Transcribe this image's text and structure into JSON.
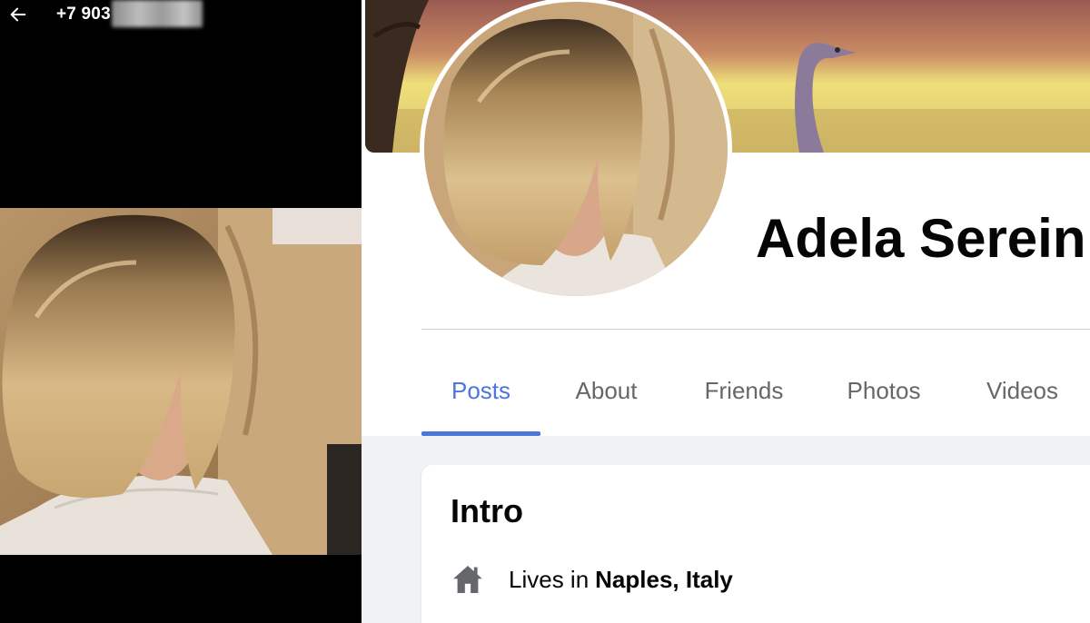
{
  "phone_viewer": {
    "back_icon": "arrow-left-icon",
    "phone_number_visible": "+7 903",
    "phone_number_redacted": true
  },
  "profile": {
    "name": "Adela Serein",
    "tabs": [
      {
        "label": "Posts",
        "active": true
      },
      {
        "label": "About",
        "active": false
      },
      {
        "label": "Friends",
        "active": false
      },
      {
        "label": "Photos",
        "active": false
      },
      {
        "label": "Videos",
        "active": false
      }
    ],
    "intro": {
      "title": "Intro",
      "lives_prefix": "Lives in",
      "lives_place": "Naples, Italy",
      "icon": "home-icon"
    }
  },
  "colors": {
    "accent": "#4a76de",
    "tab_text": "#65676b",
    "page_bg": "#f0f2f5",
    "viewer_bg": "#000000"
  }
}
